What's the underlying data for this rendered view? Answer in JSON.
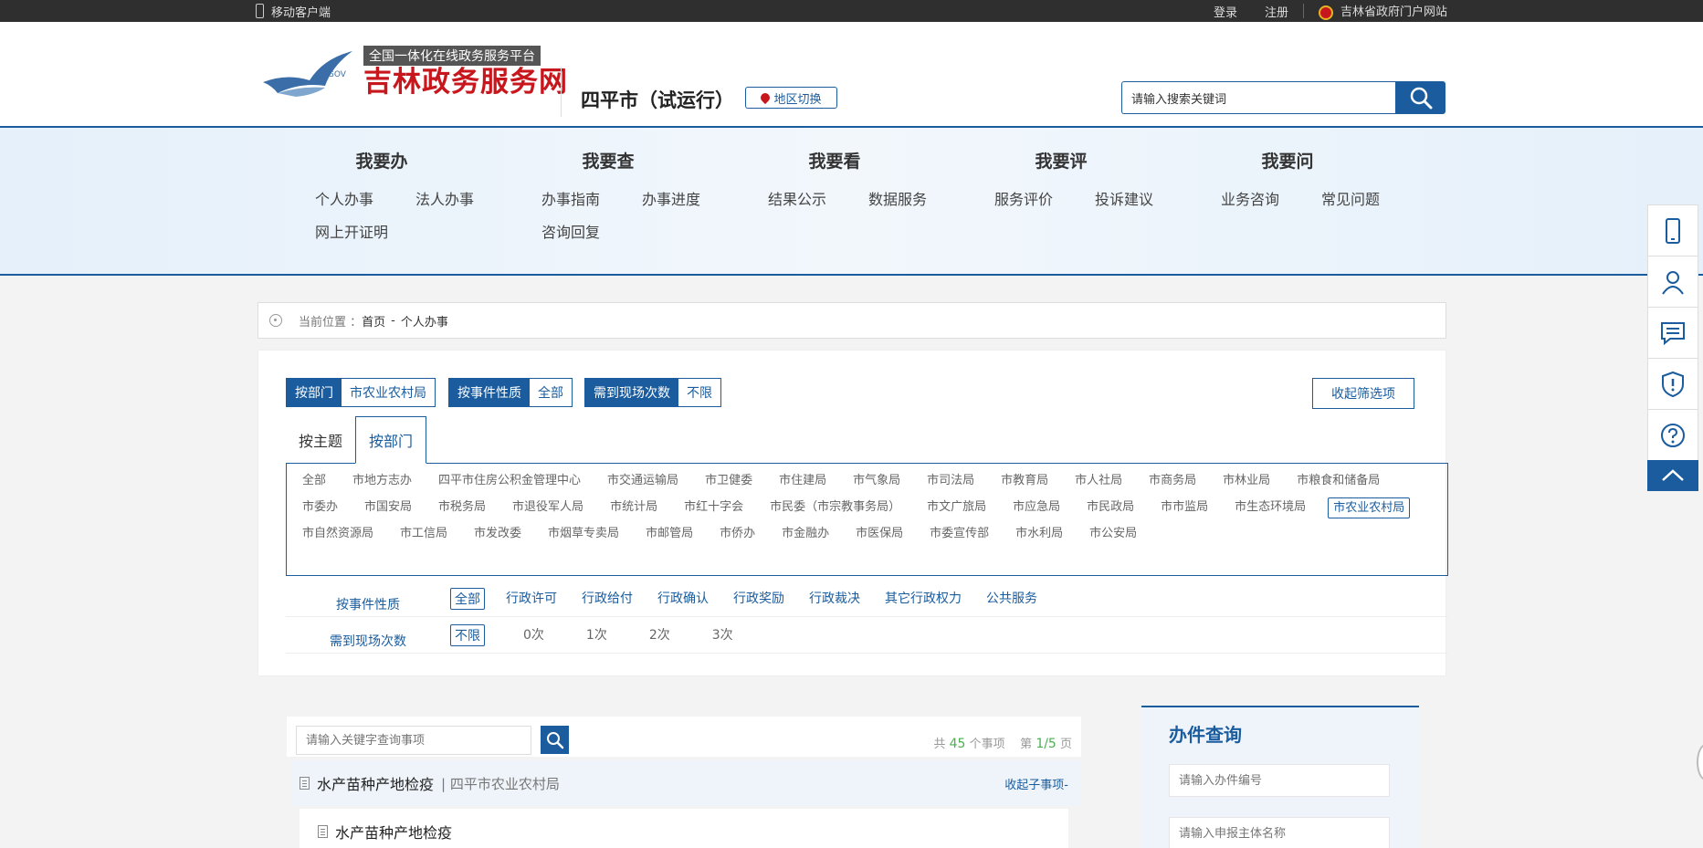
{
  "topbar": {
    "mobile_label": "移动客户端",
    "login": "登录",
    "register": "注册",
    "portal": "吉林省政府门户网站"
  },
  "header": {
    "slogan": "全国一体化在线政务服务平台",
    "brand": "吉林政务服务网",
    "logo_small": ".GOV",
    "city": "四平市（试运行）",
    "region_switch": "地区切换",
    "search_value": "请输入搜索关键词"
  },
  "nav": [
    {
      "title": "我要办",
      "items": [
        "个人办事",
        "法人办事",
        "网上开证明"
      ]
    },
    {
      "title": "我要查",
      "items": [
        "办事指南",
        "办事进度",
        "咨询回复"
      ]
    },
    {
      "title": "我要看",
      "items": [
        "结果公示",
        "数据服务"
      ]
    },
    {
      "title": "我要评",
      "items": [
        "服务评价",
        "投诉建议"
      ]
    },
    {
      "title": "我要问",
      "items": [
        "业务咨询",
        "常见问题"
      ]
    }
  ],
  "breadcrumb": {
    "prefix": "当前位置 ：",
    "home": "首页",
    "sep": "-",
    "current": "个人办事"
  },
  "filter": {
    "chips": [
      {
        "key": "按部门",
        "value": "市农业农村局"
      },
      {
        "key": "按事件性质",
        "value": "全部"
      },
      {
        "key": "需到现场次数",
        "value": "不限"
      }
    ],
    "collapse_label": "收起筛选项",
    "tabs": [
      "按主题",
      "按部门"
    ],
    "departments": [
      "全部",
      "市地方志办",
      "四平市住房公积金管理中心",
      "市交通运输局",
      "市卫健委",
      "市住建局",
      "市气象局",
      "市司法局",
      "市教育局",
      "市人社局",
      "市商务局",
      "市林业局",
      "市粮食和储备局",
      "市委办",
      "市国安局",
      "市税务局",
      "市退役军人局",
      "市统计局",
      "市红十字会",
      "市民委（市宗教事务局）",
      "市文广旅局",
      "市应急局",
      "市民政局",
      "市市监局",
      "市生态环境局",
      "市农业农村局",
      "市自然资源局",
      "市工信局",
      "市发改委",
      "市烟草专卖局",
      "市邮管局",
      "市侨办",
      "市金融办",
      "市医保局",
      "市委宣传部",
      "市水利局",
      "市公安局"
    ],
    "selected_department": "市农业农村局",
    "nature_label": "按事件性质",
    "nature_options": [
      "全部",
      "行政许可",
      "行政给付",
      "行政确认",
      "行政奖励",
      "行政裁决",
      "其它行政权力",
      "公共服务"
    ],
    "visits_label": "需到现场次数",
    "visits_options": [
      "不限",
      "0次",
      "1次",
      "2次",
      "3次"
    ]
  },
  "list": {
    "search_placeholder": "请输入关键字查询事项",
    "count_prefix": "共",
    "count": "45",
    "count_suffix": "个事项",
    "page_prefix": "第",
    "page": "1/5",
    "page_suffix": "页",
    "item_name": "水产苗种产地检疫",
    "item_dept": "| 四平市农业农村局",
    "item_toggle": "收起子事项-",
    "sub_item_name": "水产苗种产地检疫"
  },
  "query": {
    "title": "办件查询",
    "number_placeholder": "请输入办件编号",
    "name_placeholder": "请输入申报主体名称"
  },
  "colors": {
    "accent": "#1a5c9e",
    "brand_red": "#c8161d"
  }
}
